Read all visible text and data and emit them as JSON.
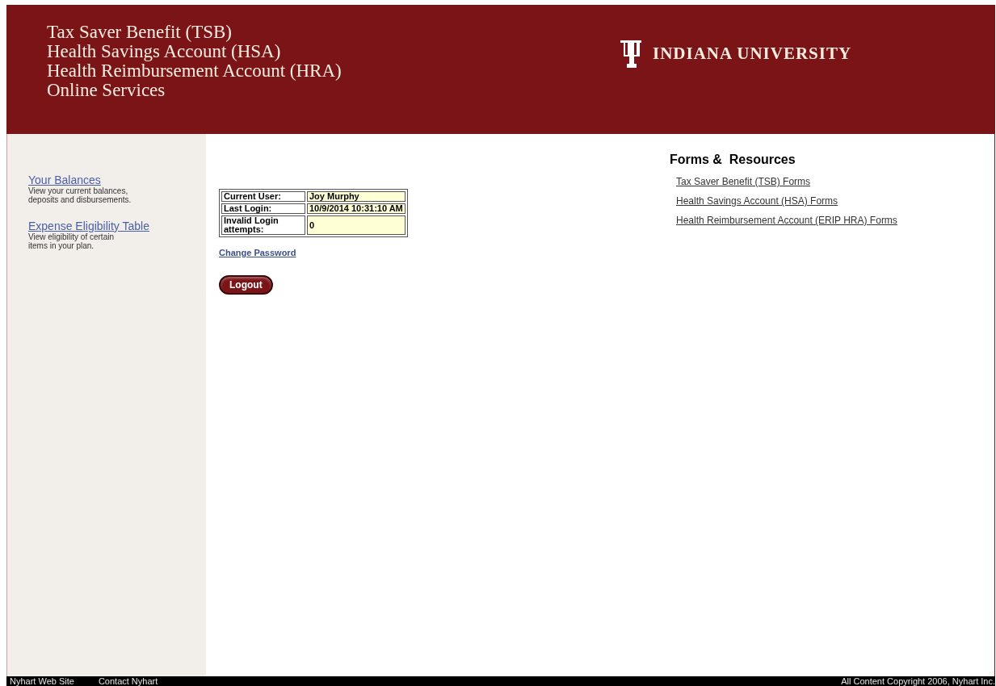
{
  "header": {
    "title_lines": [
      "Tax Saver Benefit (TSB)",
      "Health Savings Account (HSA)",
      "Health Reimbursement Account (HRA)",
      "Online Services"
    ],
    "logo_text": "INDIANA UNIVERSITY"
  },
  "sidebar": {
    "items": [
      {
        "label": "Your Balances",
        "description": "View your current balances, deposits and disbursements."
      },
      {
        "label": "Expense Eligibility Table",
        "description": "View eligibility of certain items in your plan."
      }
    ]
  },
  "login_info": {
    "rows": [
      {
        "label": "Current User:",
        "value": "Joy Murphy"
      },
      {
        "label": "Last Login:",
        "value": "10/9/2014 10:31:10 AM"
      },
      {
        "label": "Invalid Login attempts:",
        "value": "0"
      }
    ]
  },
  "change_password": "Change Password",
  "logout_button": "Logout",
  "forms": {
    "title": "Forms &  Resources",
    "links": [
      "Tax Saver Benefit (TSB) Forms",
      "Health Savings Account (HSA) Forms",
      "Health Reimbursement Account (ERIP HRA) Forms"
    ]
  },
  "footer": {
    "links": [
      "Nyhart Web Site",
      "Contact Nyhart"
    ],
    "copyright": "All Content Copyright 2006, Nyhart Inc."
  }
}
